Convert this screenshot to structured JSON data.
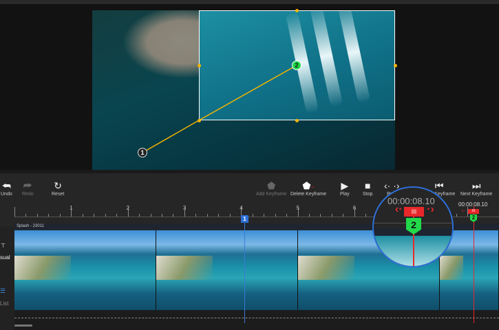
{
  "preview": {
    "keyframes": [
      {
        "label": "1"
      },
      {
        "label": "2"
      }
    ]
  },
  "toolbar": {
    "undo": "Undo",
    "redo": "Redo",
    "reset": "Reset",
    "add_keyframe": "Add Keyframe",
    "delete_keyframe": "Delete Keyframe",
    "play": "Play",
    "stop": "Stop",
    "prev": "Prev",
    "prev_keyframe": "Prev Keyframe",
    "next_keyframe": "Next Keyframe"
  },
  "timeline": {
    "ruler_labels": [
      "1",
      "2",
      "3",
      "4",
      "5",
      "6"
    ],
    "track_name": "Splash - 23011",
    "current_time": "00:00:08.10",
    "magnified_time": "00:00:08.10",
    "playhead_marker": "1",
    "keyframe_marker": "2",
    "handle_marker": "III"
  },
  "side": {
    "visual": "sual",
    "list": "List"
  },
  "colors": {
    "accent_blue": "#2d6fd6",
    "keyframe_red": "#e8282a",
    "keyframe_green": "#22d94a",
    "path": "#f5b400"
  }
}
